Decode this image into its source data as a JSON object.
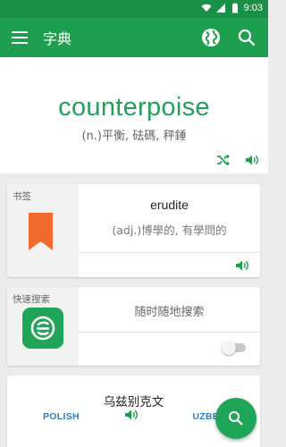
{
  "status": {
    "time": "9:03"
  },
  "appbar": {
    "title": "字典"
  },
  "hero": {
    "word": "counterpoise",
    "definition": "(n.)平衡, 砝碼, 秤錘"
  },
  "bookmark_card": {
    "label": "书签",
    "word": "erudite",
    "definition": "(adj.)博學的, 有學問的"
  },
  "search_card": {
    "label": "快速搜索",
    "message": "随时随地搜索",
    "toggle_on": false
  },
  "language_card": {
    "language": "乌兹别克文",
    "pair_left": "POLISH",
    "pair_right": "UZBEK"
  },
  "colors": {
    "primary": "#1e9e4f",
    "accent": "#24a05a",
    "bookmark": "#f26b2d",
    "link": "#2b7fc4"
  }
}
